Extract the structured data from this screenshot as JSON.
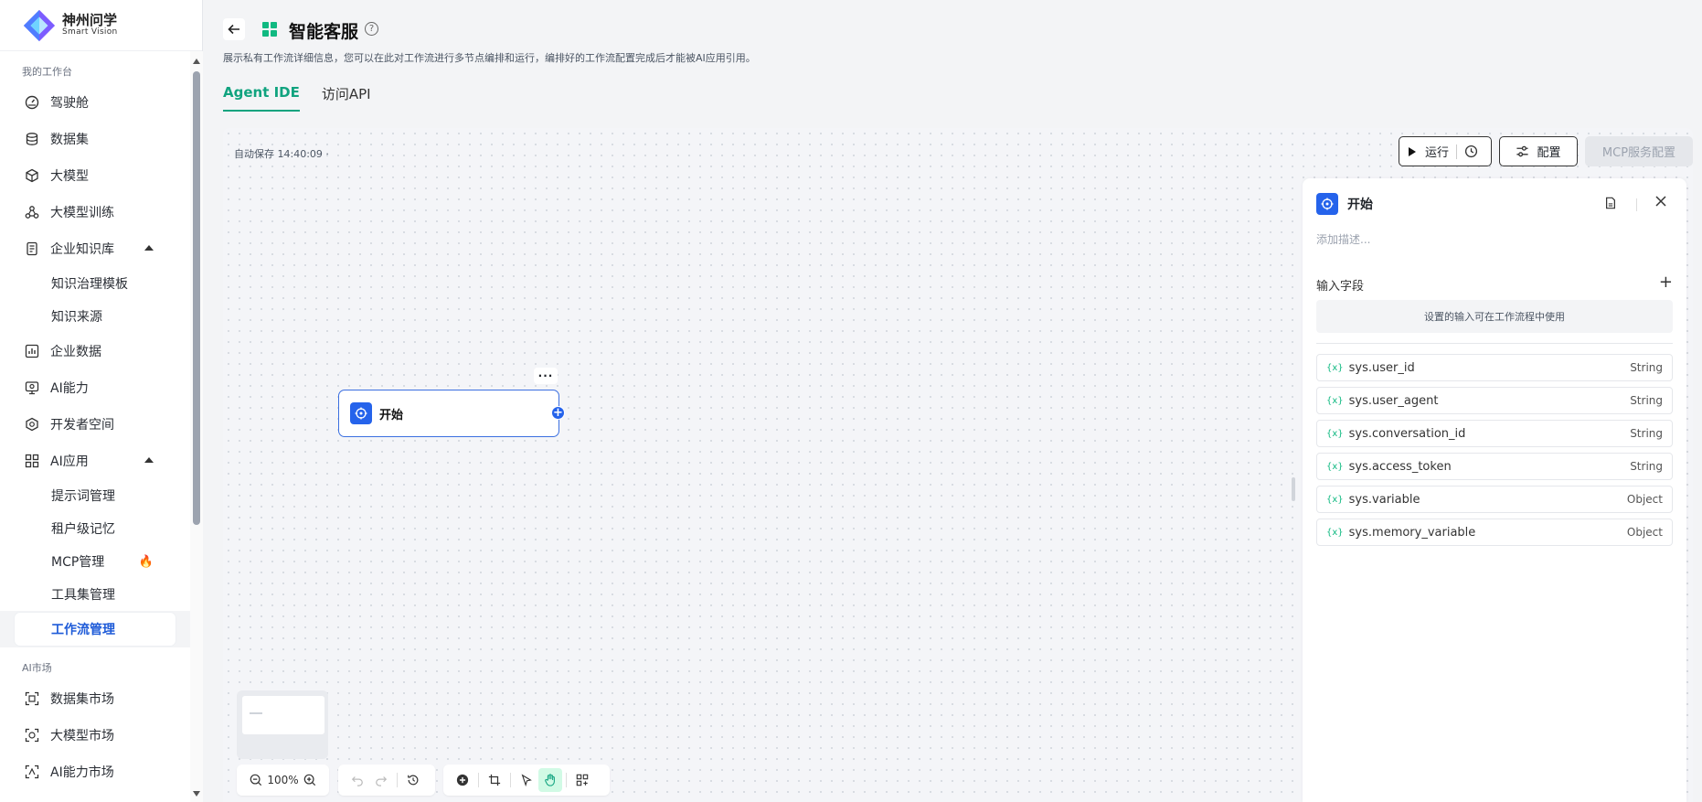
{
  "brand": {
    "name_cn": "神州问学",
    "name_en": "Smart Vision"
  },
  "sidebar": {
    "section_workbench": "我的工作台",
    "items": [
      {
        "label": "驾驶舱",
        "icon": "dashboard-icon"
      },
      {
        "label": "数据集",
        "icon": "database-icon"
      },
      {
        "label": "大模型",
        "icon": "cube-icon"
      },
      {
        "label": "大模型训练",
        "icon": "training-icon"
      },
      {
        "label": "企业知识库",
        "icon": "knowledge-icon",
        "expanded": true
      },
      {
        "label": "企业数据",
        "icon": "chart-icon"
      },
      {
        "label": "AI能力",
        "icon": "ai-capability-icon"
      },
      {
        "label": "开发者空间",
        "icon": "developer-icon"
      },
      {
        "label": "AI应用",
        "icon": "apps-grid-icon",
        "expanded": true
      }
    ],
    "knowledge_sub": [
      "知识治理模板",
      "知识来源"
    ],
    "app_sub": [
      "提示词管理",
      "租户级记忆",
      "MCP管理",
      "工具集管理",
      "工作流管理"
    ],
    "active_sub": "工作流管理",
    "section_market": "AI市场",
    "market_items": [
      {
        "label": "数据集市场",
        "icon": "dataset-market-icon"
      },
      {
        "label": "大模型市场",
        "icon": "model-market-icon"
      },
      {
        "label": "AI能力市场",
        "icon": "ai-market-icon"
      }
    ]
  },
  "header": {
    "title": "智能客服",
    "description": "展示私有工作流详细信息，您可以在此对工作流进行多节点编排和运行，编排好的工作流配置完成后才能被AI应用引用。",
    "tabs": [
      {
        "label": "Agent IDE",
        "active": true
      },
      {
        "label": "访问API",
        "active": false
      }
    ]
  },
  "canvas": {
    "autosave": "自动保存 14:40:09 ·",
    "run_label": "运行",
    "config_label": "配置",
    "mcp_label": "MCP服务配置",
    "node_title": "开始",
    "zoom": "100%"
  },
  "panel": {
    "title": "开始",
    "description_placeholder": "添加描述...",
    "fields_title": "输入字段",
    "hint": "设置的输入可在工作流程中使用",
    "fields": [
      {
        "name": "sys.user_id",
        "type": "String"
      },
      {
        "name": "sys.user_agent",
        "type": "String"
      },
      {
        "name": "sys.conversation_id",
        "type": "String"
      },
      {
        "name": "sys.access_token",
        "type": "String"
      },
      {
        "name": "sys.variable",
        "type": "Object"
      },
      {
        "name": "sys.memory_variable",
        "type": "Object"
      }
    ]
  },
  "colors": {
    "accent": "#10a37f",
    "primary": "#2563eb",
    "active_nav": "#1e5bd8",
    "fire": "#ef4444"
  }
}
